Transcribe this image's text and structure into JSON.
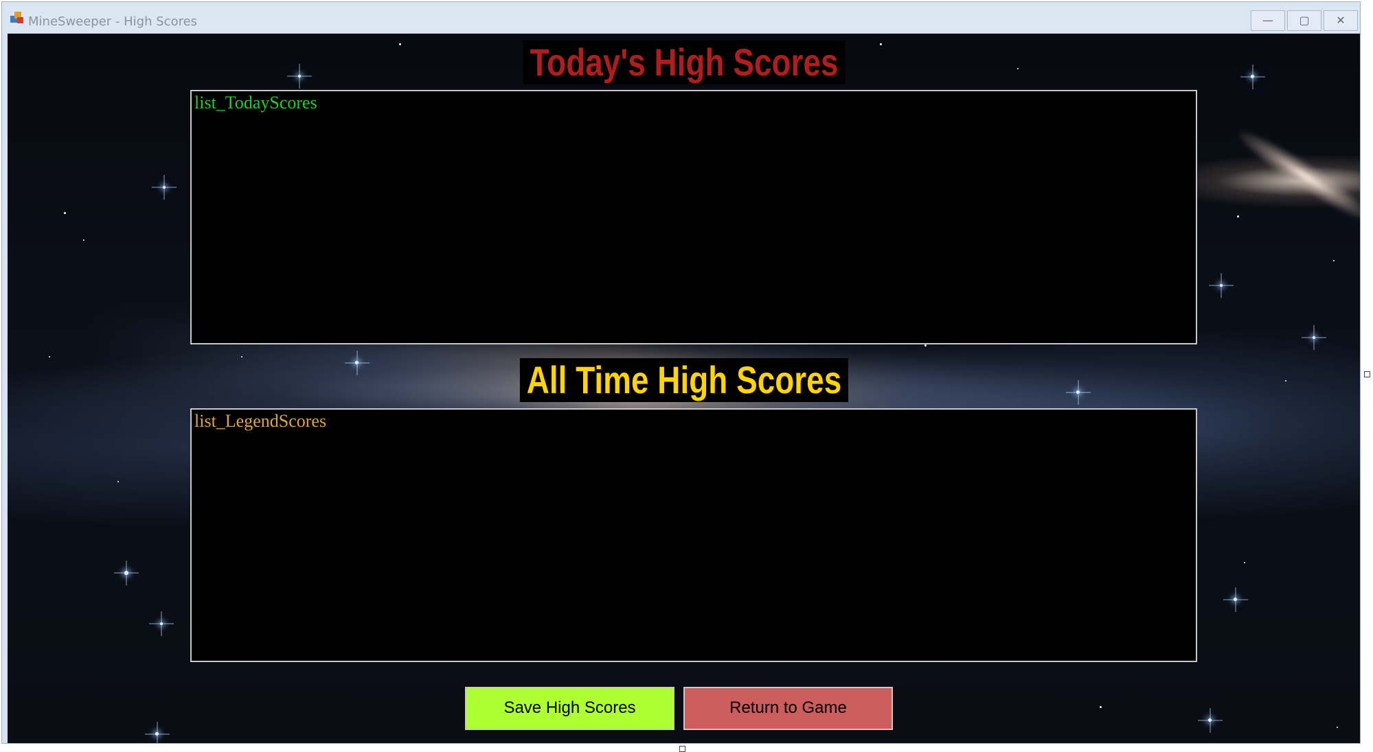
{
  "window": {
    "title": "MineSweeper - High Scores",
    "controls": {
      "minimize": "—",
      "maximize": "▢",
      "close": "✕"
    }
  },
  "headings": {
    "today": "Today's High Scores",
    "all_time": "All Time High Scores"
  },
  "lists": {
    "today": "list_TodayScores",
    "legend": "list_LegendScores"
  },
  "buttons": {
    "save": "Save High Scores",
    "return": "Return to Game"
  },
  "colors": {
    "today_heading": "#b31c1c",
    "all_time_heading": "#ffd400",
    "today_list_text": "#1fd12a",
    "legend_list_text": "#e0a53d",
    "save_button": "#adff2f",
    "return_button": "#cd5c5c"
  },
  "icons": [
    "app-icon",
    "minimize-icon",
    "maximize-icon",
    "close-icon"
  ]
}
